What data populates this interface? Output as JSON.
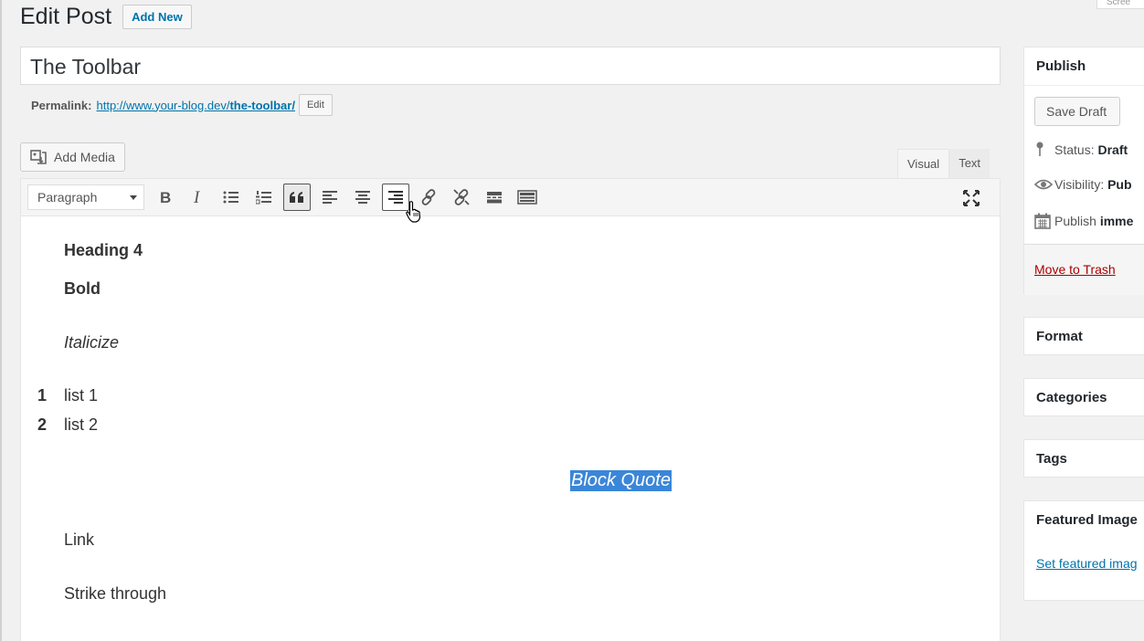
{
  "header": {
    "title": "Edit Post",
    "add_new": "Add New",
    "screen_options": "Scree"
  },
  "post": {
    "title": "The Toolbar",
    "permalink_label": "Permalink:",
    "permalink_base": "http://www.your-blog.dev/",
    "permalink_slug": "the-toolbar/",
    "edit_button": "Edit"
  },
  "editor": {
    "add_media": "Add Media",
    "tabs": {
      "visual": "Visual",
      "text": "Text"
    },
    "format_select": "Paragraph",
    "toolbar_icons": [
      "bold-icon",
      "italic-icon",
      "bulleted-list-icon",
      "numbered-list-icon",
      "blockquote-icon",
      "align-left-icon",
      "align-center-icon",
      "align-right-icon",
      "insert-link-icon",
      "remove-link-icon",
      "read-more-icon",
      "toolbar-toggle-icon",
      "fullscreen-icon"
    ],
    "content": {
      "heading4": "Heading 4",
      "bold": "Bold",
      "italic": "Italicize",
      "list": [
        {
          "num": "1",
          "text": "list 1"
        },
        {
          "num": "2",
          "text": "list 2"
        }
      ],
      "blockquote": "Block Quote",
      "link": "Link",
      "strike": "Strike through"
    }
  },
  "sidebar": {
    "publish": {
      "title": "Publish",
      "save_draft": "Save Draft",
      "status_label": "Status:",
      "status_value": "Draft",
      "visibility_label": "Visibility:",
      "visibility_value": "Pub",
      "publish_label": "Publish",
      "publish_value": "imme",
      "move_to_trash": "Move to Trash"
    },
    "format_title": "Format",
    "categories_title": "Categories",
    "tags_title": "Tags",
    "featured": {
      "title": "Featured Image",
      "set_link": "Set featured imag"
    }
  },
  "colors": {
    "link": "#0073aa",
    "trash": "#aa0000",
    "selection": "#3a86d8",
    "background": "#f1f1f1"
  }
}
